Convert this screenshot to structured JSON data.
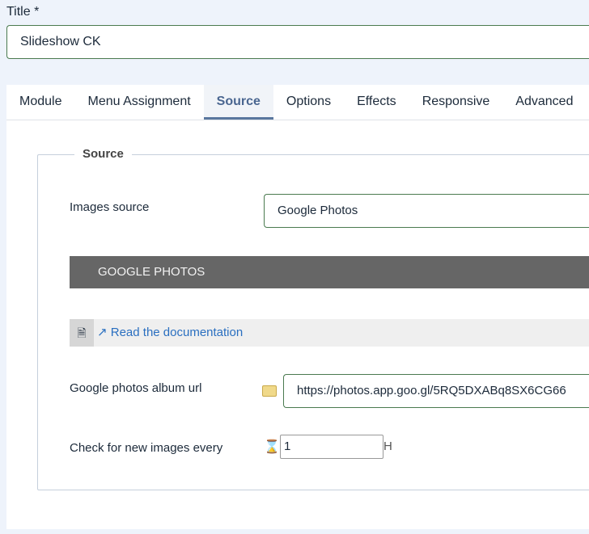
{
  "title": {
    "label": "Title *",
    "value": "Slideshow CK"
  },
  "tabs": [
    {
      "label": "Module"
    },
    {
      "label": "Menu Assignment"
    },
    {
      "label": "Source"
    },
    {
      "label": "Options"
    },
    {
      "label": "Effects"
    },
    {
      "label": "Responsive"
    },
    {
      "label": "Advanced"
    }
  ],
  "active_tab": "Source",
  "source": {
    "legend": "Source",
    "images_source_label": "Images source",
    "images_source_value": "Google Photos",
    "section_header": "GOOGLE PHOTOS",
    "doc_link": "Read the documentation",
    "album_url_label": "Google photos album url",
    "album_url_value": "https://photos.app.goo.gl/5RQ5DXABq8SX6CG66",
    "check_label": "Check for new images every",
    "check_value": "1",
    "check_unit": "H"
  },
  "colors": {
    "accent": "#5a779e",
    "link": "#2a6fc0",
    "input_border": "#4a7a4f",
    "header_bg": "#666666"
  }
}
